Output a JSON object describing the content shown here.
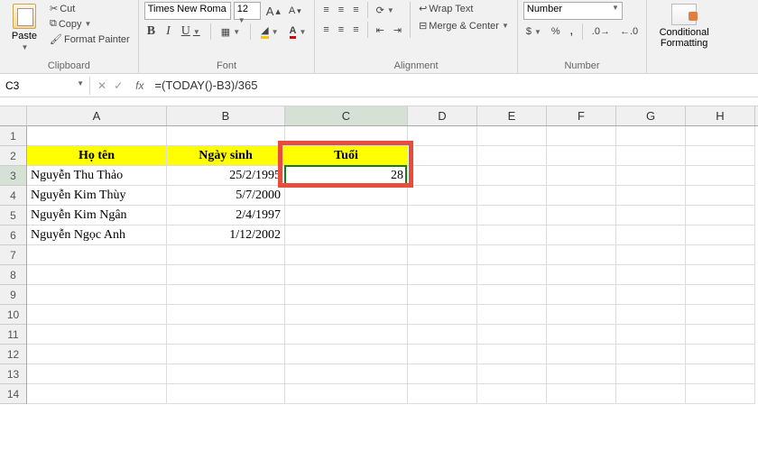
{
  "ribbon": {
    "clipboard": {
      "paste": "Paste",
      "cut": "Cut",
      "copy": "Copy",
      "format_painter": "Format Painter",
      "label": "Clipboard"
    },
    "font": {
      "name": "Times New Roma",
      "size": "12",
      "bold": "B",
      "italic": "I",
      "underline": "U",
      "label": "Font"
    },
    "alignment": {
      "wrap": "Wrap Text",
      "merge": "Merge & Center",
      "label": "Alignment"
    },
    "number": {
      "format": "Number",
      "label": "Number"
    },
    "styles": {
      "conditional": "Conditional Formatting",
      "label": ""
    }
  },
  "formula_bar": {
    "cell_ref": "C3",
    "formula": "=(TODAY()-B3)/365"
  },
  "columns": [
    "A",
    "B",
    "C",
    "D",
    "E",
    "F",
    "G",
    "H"
  ],
  "row_numbers": [
    "1",
    "2",
    "3",
    "4",
    "5",
    "6",
    "7",
    "8",
    "9",
    "10",
    "11",
    "12",
    "13",
    "14"
  ],
  "headers": {
    "name": "Họ tên",
    "dob": "Ngày sinh",
    "age": "Tuổi"
  },
  "data": [
    {
      "name": "Nguyễn Thu Thảo",
      "dob": "25/2/1995",
      "age": "28"
    },
    {
      "name": "Nguyễn Kim Thùy",
      "dob": "5/7/2000",
      "age": ""
    },
    {
      "name": "Nguyễn Kim Ngân",
      "dob": "2/4/1997",
      "age": ""
    },
    {
      "name": "Nguyễn Ngọc Anh",
      "dob": "1/12/2002",
      "age": ""
    }
  ],
  "active": {
    "col_index": 2,
    "row_index": 2
  }
}
